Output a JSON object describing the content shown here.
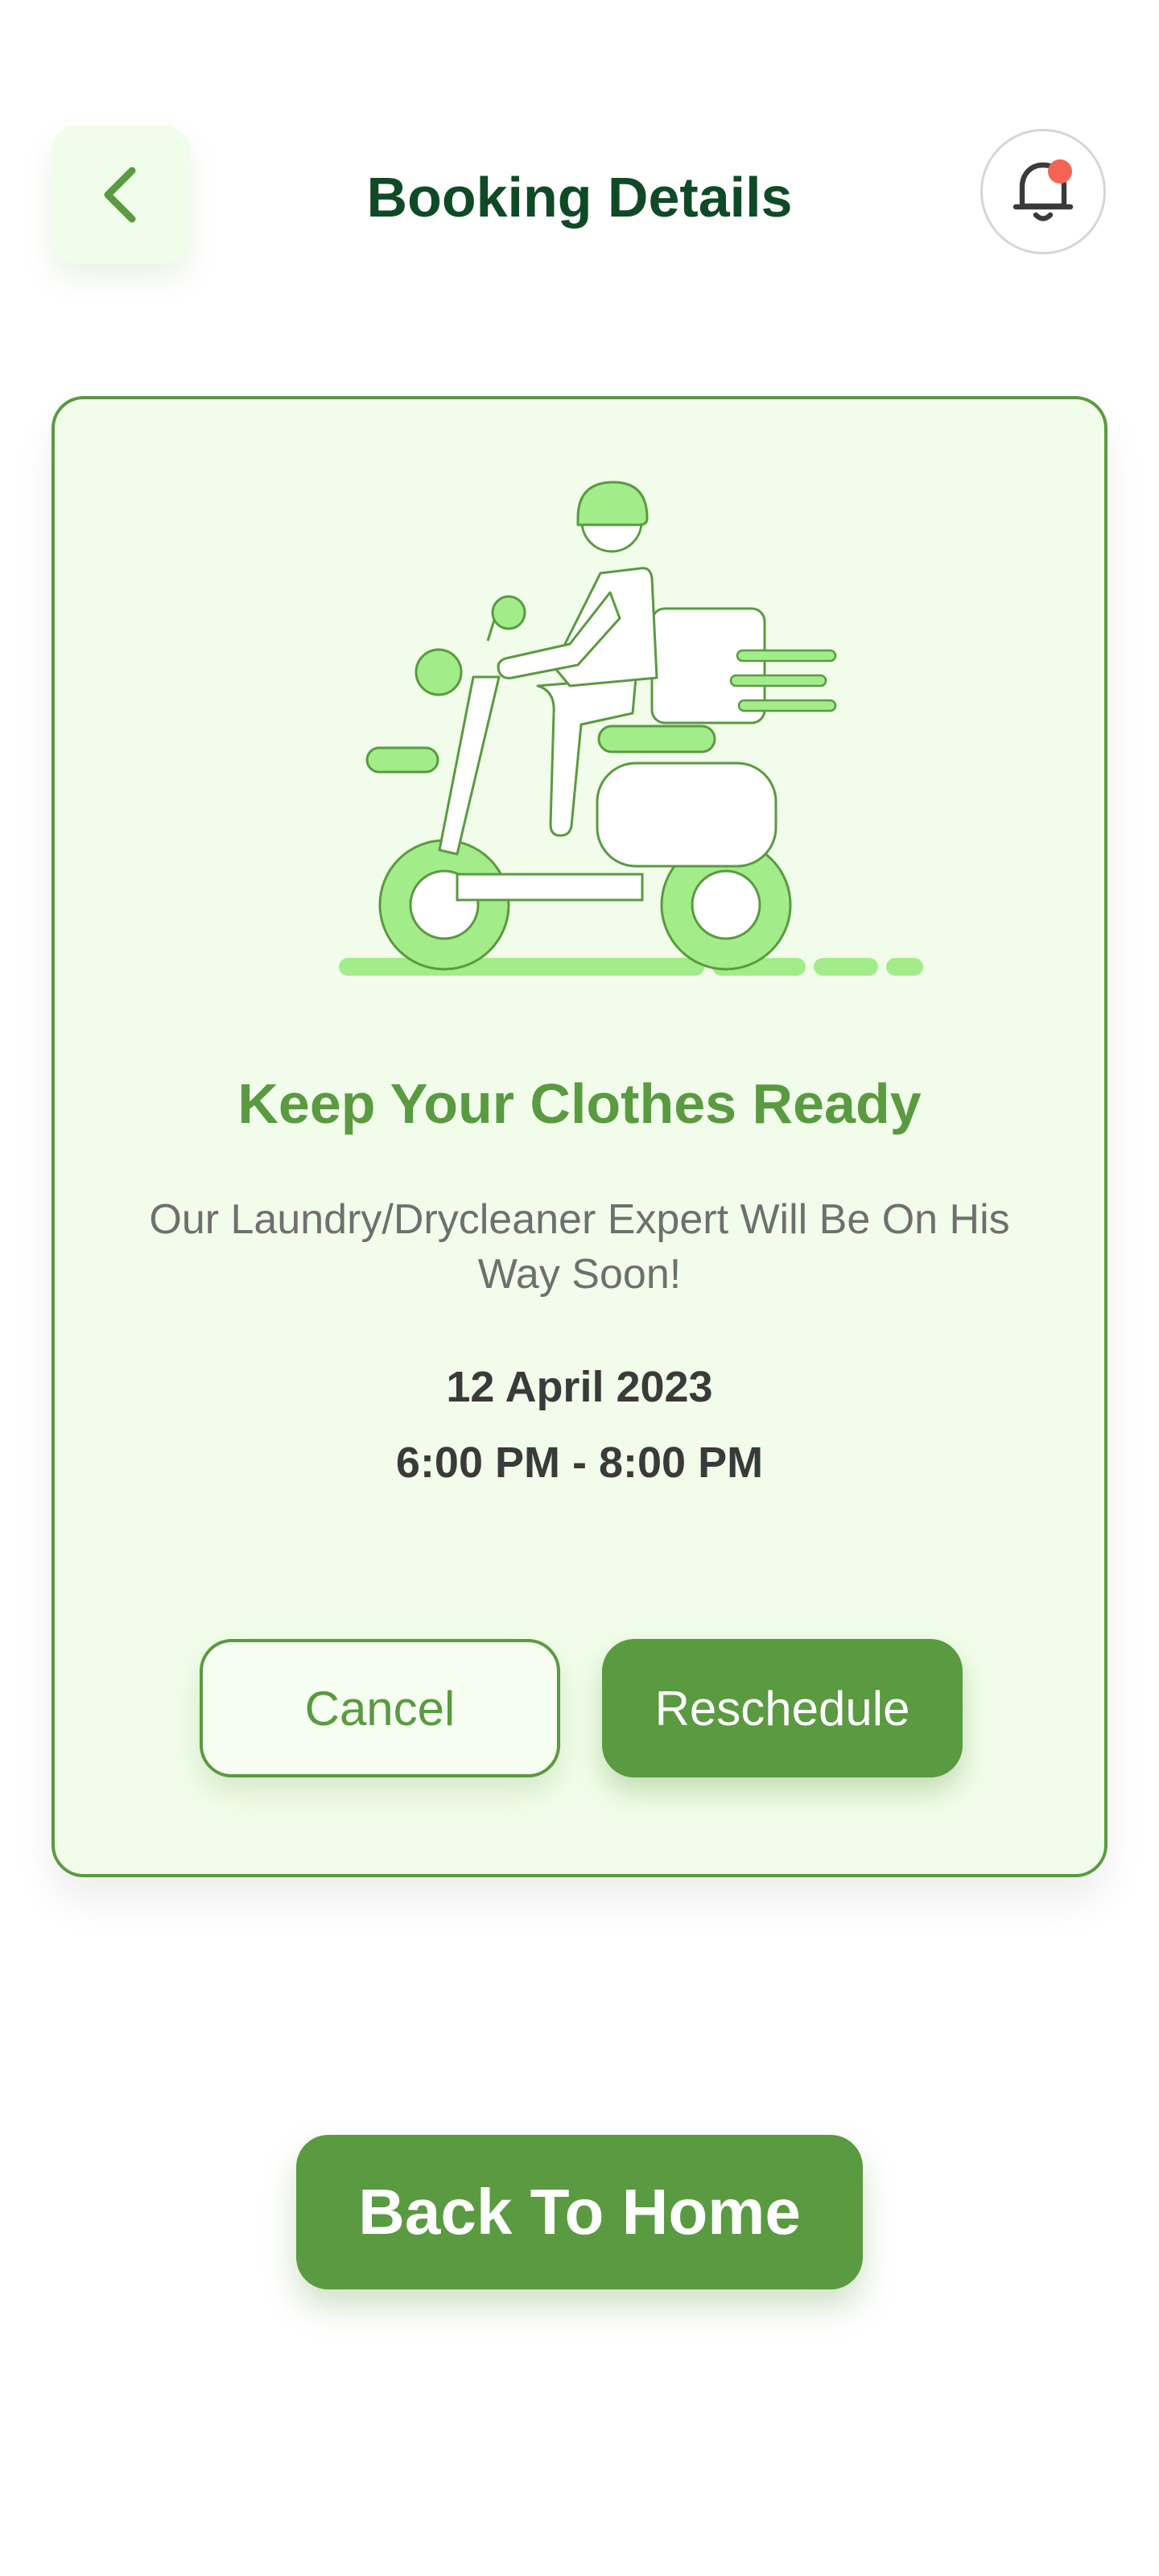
{
  "header": {
    "title": "Booking Details",
    "back_icon": "chevron-left-icon",
    "notification_icon": "bell-icon"
  },
  "card": {
    "illustration": "delivery-scooter-illustration",
    "heading": "Keep Your Clothes Ready",
    "subtitle": "Our Laundry/Drycleaner Expert Will Be On His Way Soon!",
    "date": "12 April 2023",
    "time": "6:00 PM - 8:00 PM",
    "cancel_label": "Cancel",
    "reschedule_label": "Reschedule"
  },
  "footer": {
    "home_label": "Back To Home"
  },
  "colors": {
    "primary": "#5a9a40",
    "title": "#0f4a26",
    "light_green": "#a3ec8a",
    "card_bg": "#f1fdea",
    "notification_dot": "#f36552"
  }
}
